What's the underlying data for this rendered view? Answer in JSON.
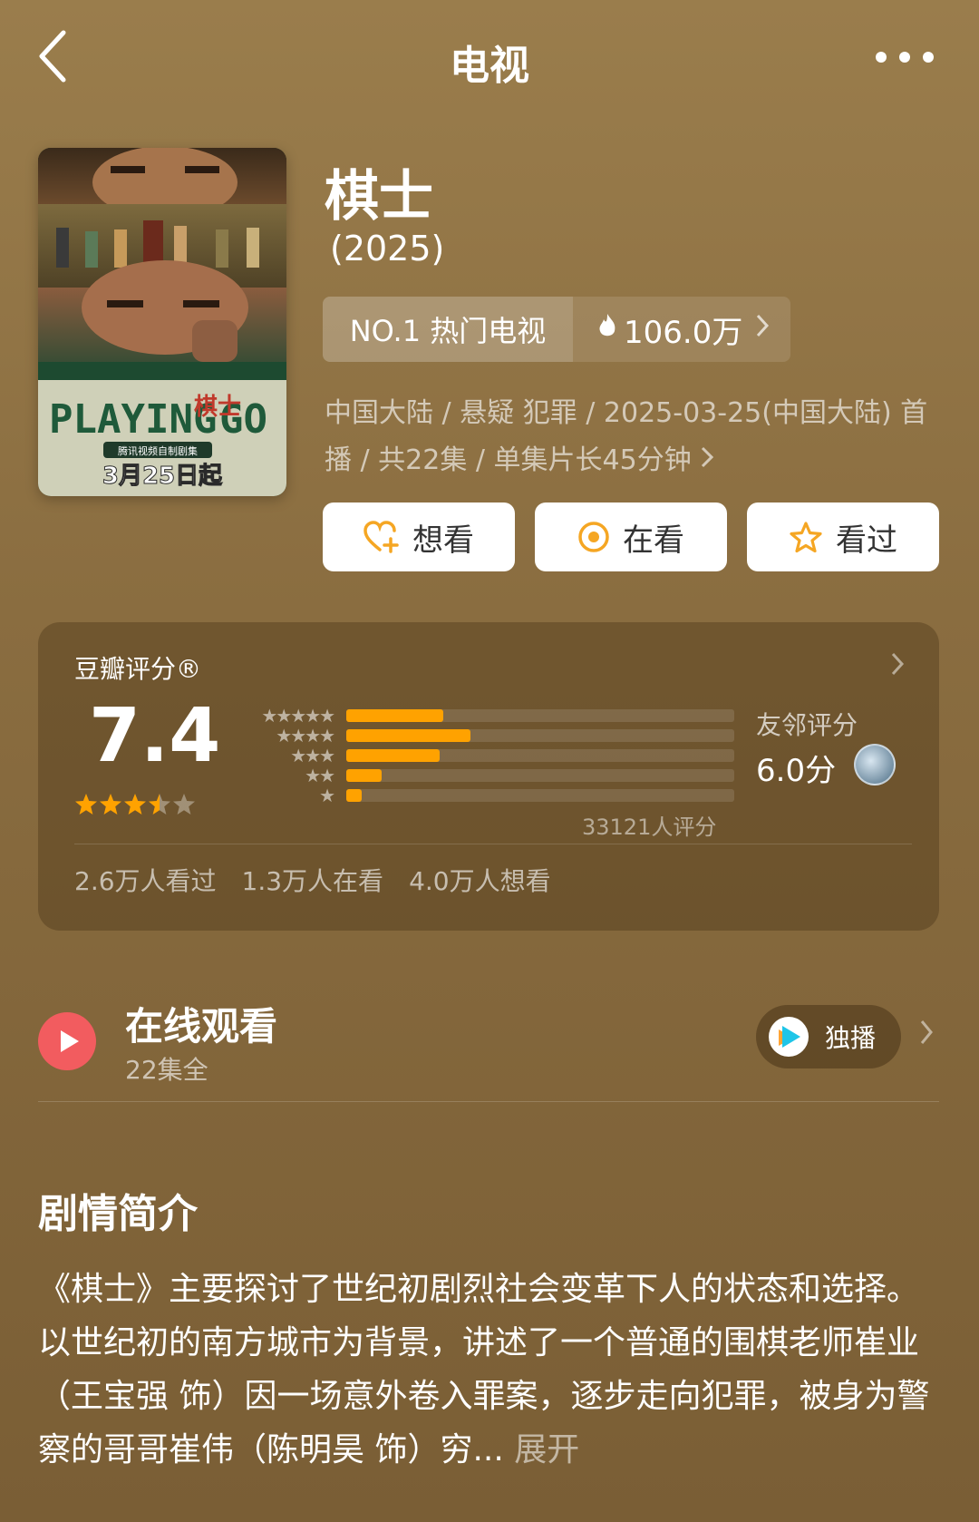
{
  "nav": {
    "title": "电视"
  },
  "poster": {
    "title_en": "PLAYING",
    "title_en_2": "GO",
    "title_cn": "棋士",
    "subtitle": "腾讯视频自制剧集",
    "date": "3月25日起"
  },
  "movie": {
    "title": "棋士",
    "year": "(2025)"
  },
  "rank": {
    "label": "NO.1 热门电视",
    "heat": "106.0万"
  },
  "meta": "中国大陆 / 悬疑 犯罪 / 2025-03-25(中国大陆) 首播 / 共22集 / 单集片长45分钟",
  "actions": {
    "want": "想看",
    "watching": "在看",
    "watched": "看过"
  },
  "rating": {
    "label": "豆瓣评分®",
    "score": "7.4",
    "stars": 3.5,
    "distribution": [
      0.25,
      0.32,
      0.24,
      0.09,
      0.04
    ],
    "count": "33121人评分",
    "friend_label": "友邻评分",
    "friend_score": "6.0分",
    "stats": {
      "watched": "2.6万人看过",
      "watching": "1.3万人在看",
      "want": "4.0万人想看"
    }
  },
  "watch": {
    "title": "在线观看",
    "episodes": "22集全",
    "exclusive": "独播"
  },
  "synopsis": {
    "title": "剧情简介",
    "text": "《棋士》主要探讨了世纪初剧烈社会变革下人的状态和选择。以世纪初的南方城市为背景，讲述了一个普通的围棋老师崔业（王宝强 饰）因一场意外卷入罪案，逐步走向犯罪，被身为警察的哥哥崔伟（陈明昊 饰）穷...",
    "expand": "展开"
  },
  "colors": {
    "accent": "#ffa200",
    "play": "#f25c5f",
    "bg": "#8a6d40"
  }
}
